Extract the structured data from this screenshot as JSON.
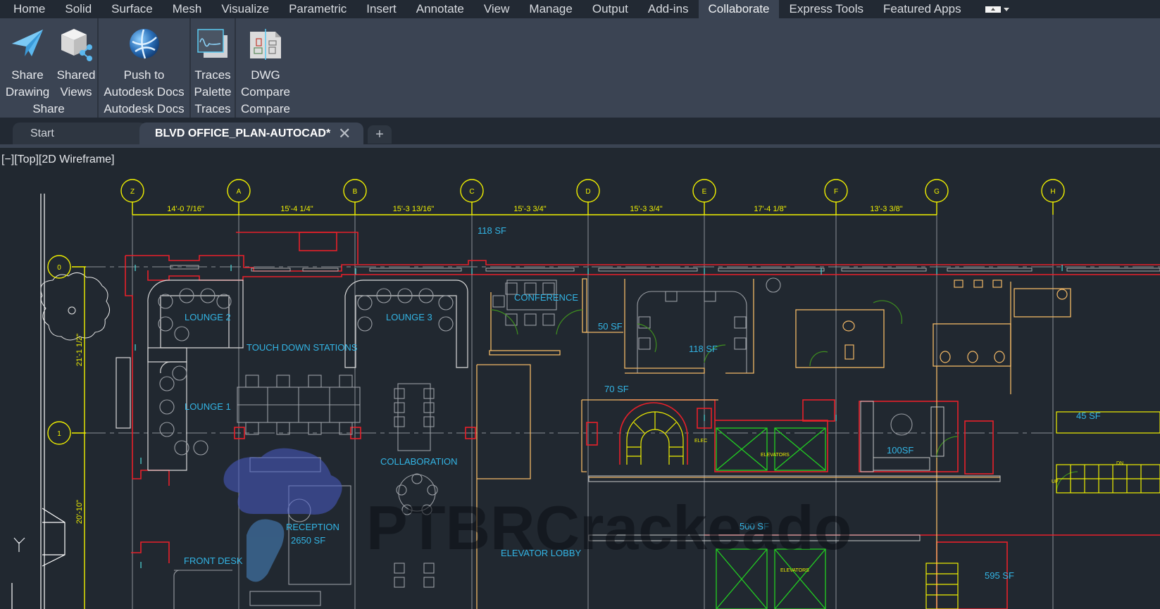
{
  "menubar": {
    "tabs": [
      "Home",
      "Solid",
      "Surface",
      "Mesh",
      "Visualize",
      "Parametric",
      "Insert",
      "Annotate",
      "View",
      "Manage",
      "Output",
      "Add-ins",
      "Collaborate",
      "Express Tools",
      "Featured Apps"
    ],
    "active_tab": "Collaborate",
    "ribbon_toggle_icon": "minimize-ribbon-icon"
  },
  "ribbon": {
    "panels": [
      {
        "title": "Share",
        "tools": [
          {
            "line1": "Share",
            "line2": "Drawing",
            "icon": "paper-plane-icon"
          },
          {
            "line1": "Shared",
            "line2": "Views",
            "icon": "shared-cube-icon"
          }
        ]
      },
      {
        "title": "Autodesk Docs",
        "tools": [
          {
            "line1": "Push to",
            "line2": "Autodesk Docs",
            "icon": "globe-icon"
          }
        ]
      },
      {
        "title": "Traces",
        "tools": [
          {
            "line1": "Traces",
            "line2": "Palette",
            "icon": "traces-palette-icon"
          }
        ]
      },
      {
        "title": "Compare",
        "tools": [
          {
            "line1": "DWG",
            "line2": "Compare",
            "icon": "dwg-compare-icon"
          }
        ]
      }
    ]
  },
  "doc_tabs": {
    "start_label": "Start",
    "active_label": "BLVD OFFICE_PLAN-AUTOCAD*",
    "close_glyph": "✕",
    "new_tab_glyph": "+"
  },
  "viewport": {
    "controls_label": "[−][Top][2D Wireframe]",
    "grid_bubbles_top": [
      "Z",
      "A",
      "B",
      "C",
      "D",
      "E",
      "F",
      "G",
      "H"
    ],
    "grid_bubbles_left": [
      "0",
      "1"
    ],
    "dimensions_top": [
      "14'-0 7/16\"",
      "15'-4 1/4\"",
      "15'-3 13/16\"",
      "15'-3 3/4\"",
      "15'-3 3/4\"",
      "17'-4 1/8\"",
      "13'-3 3/8\""
    ],
    "dimensions_left": [
      "21'-1 1/2\"",
      "20'-10\""
    ],
    "room_labels": {
      "area_118_top": "118 SF",
      "lounge2": "LOUNGE 2",
      "lounge3": "LOUNGE 3",
      "conference": "CONFERENCE",
      "sf50": "50 SF",
      "sf118": "118 SF",
      "touchdown": "TOUCH DOWN STATIONS",
      "lounge1": "LOUNGE 1",
      "sf70": "70 SF",
      "collaboration": "COLLABORATION",
      "reception": "RECEPTION",
      "reception_area": "2650 SF",
      "front_desk": "FRONT DESK",
      "elevator_lobby": "ELEVATOR LOBBY",
      "sf500": "500 SF",
      "sf100": "100SF",
      "sf45": "45 SF",
      "sf595": "595 SF",
      "elec": "ELEC",
      "elevators": "ELEVATORS",
      "elevators2": "ELEVATORS",
      "up": "UP",
      "dn": "DN"
    },
    "ucs_axis_label": "Y",
    "watermark_text": "PTBRCrackeado"
  },
  "colors": {
    "menubar_bg": "#222933",
    "ribbon_bg": "#3b4453",
    "canvas_bg": "#212830",
    "grid_yellow": "#f0f000",
    "wall_red": "#e8202a",
    "room_text_cyan": "#33b5e5",
    "door_green": "#3f8f1f",
    "furniture_gray": "#b9bcc0",
    "casework_orange": "#f2b866",
    "elevator_green": "#22d022"
  }
}
